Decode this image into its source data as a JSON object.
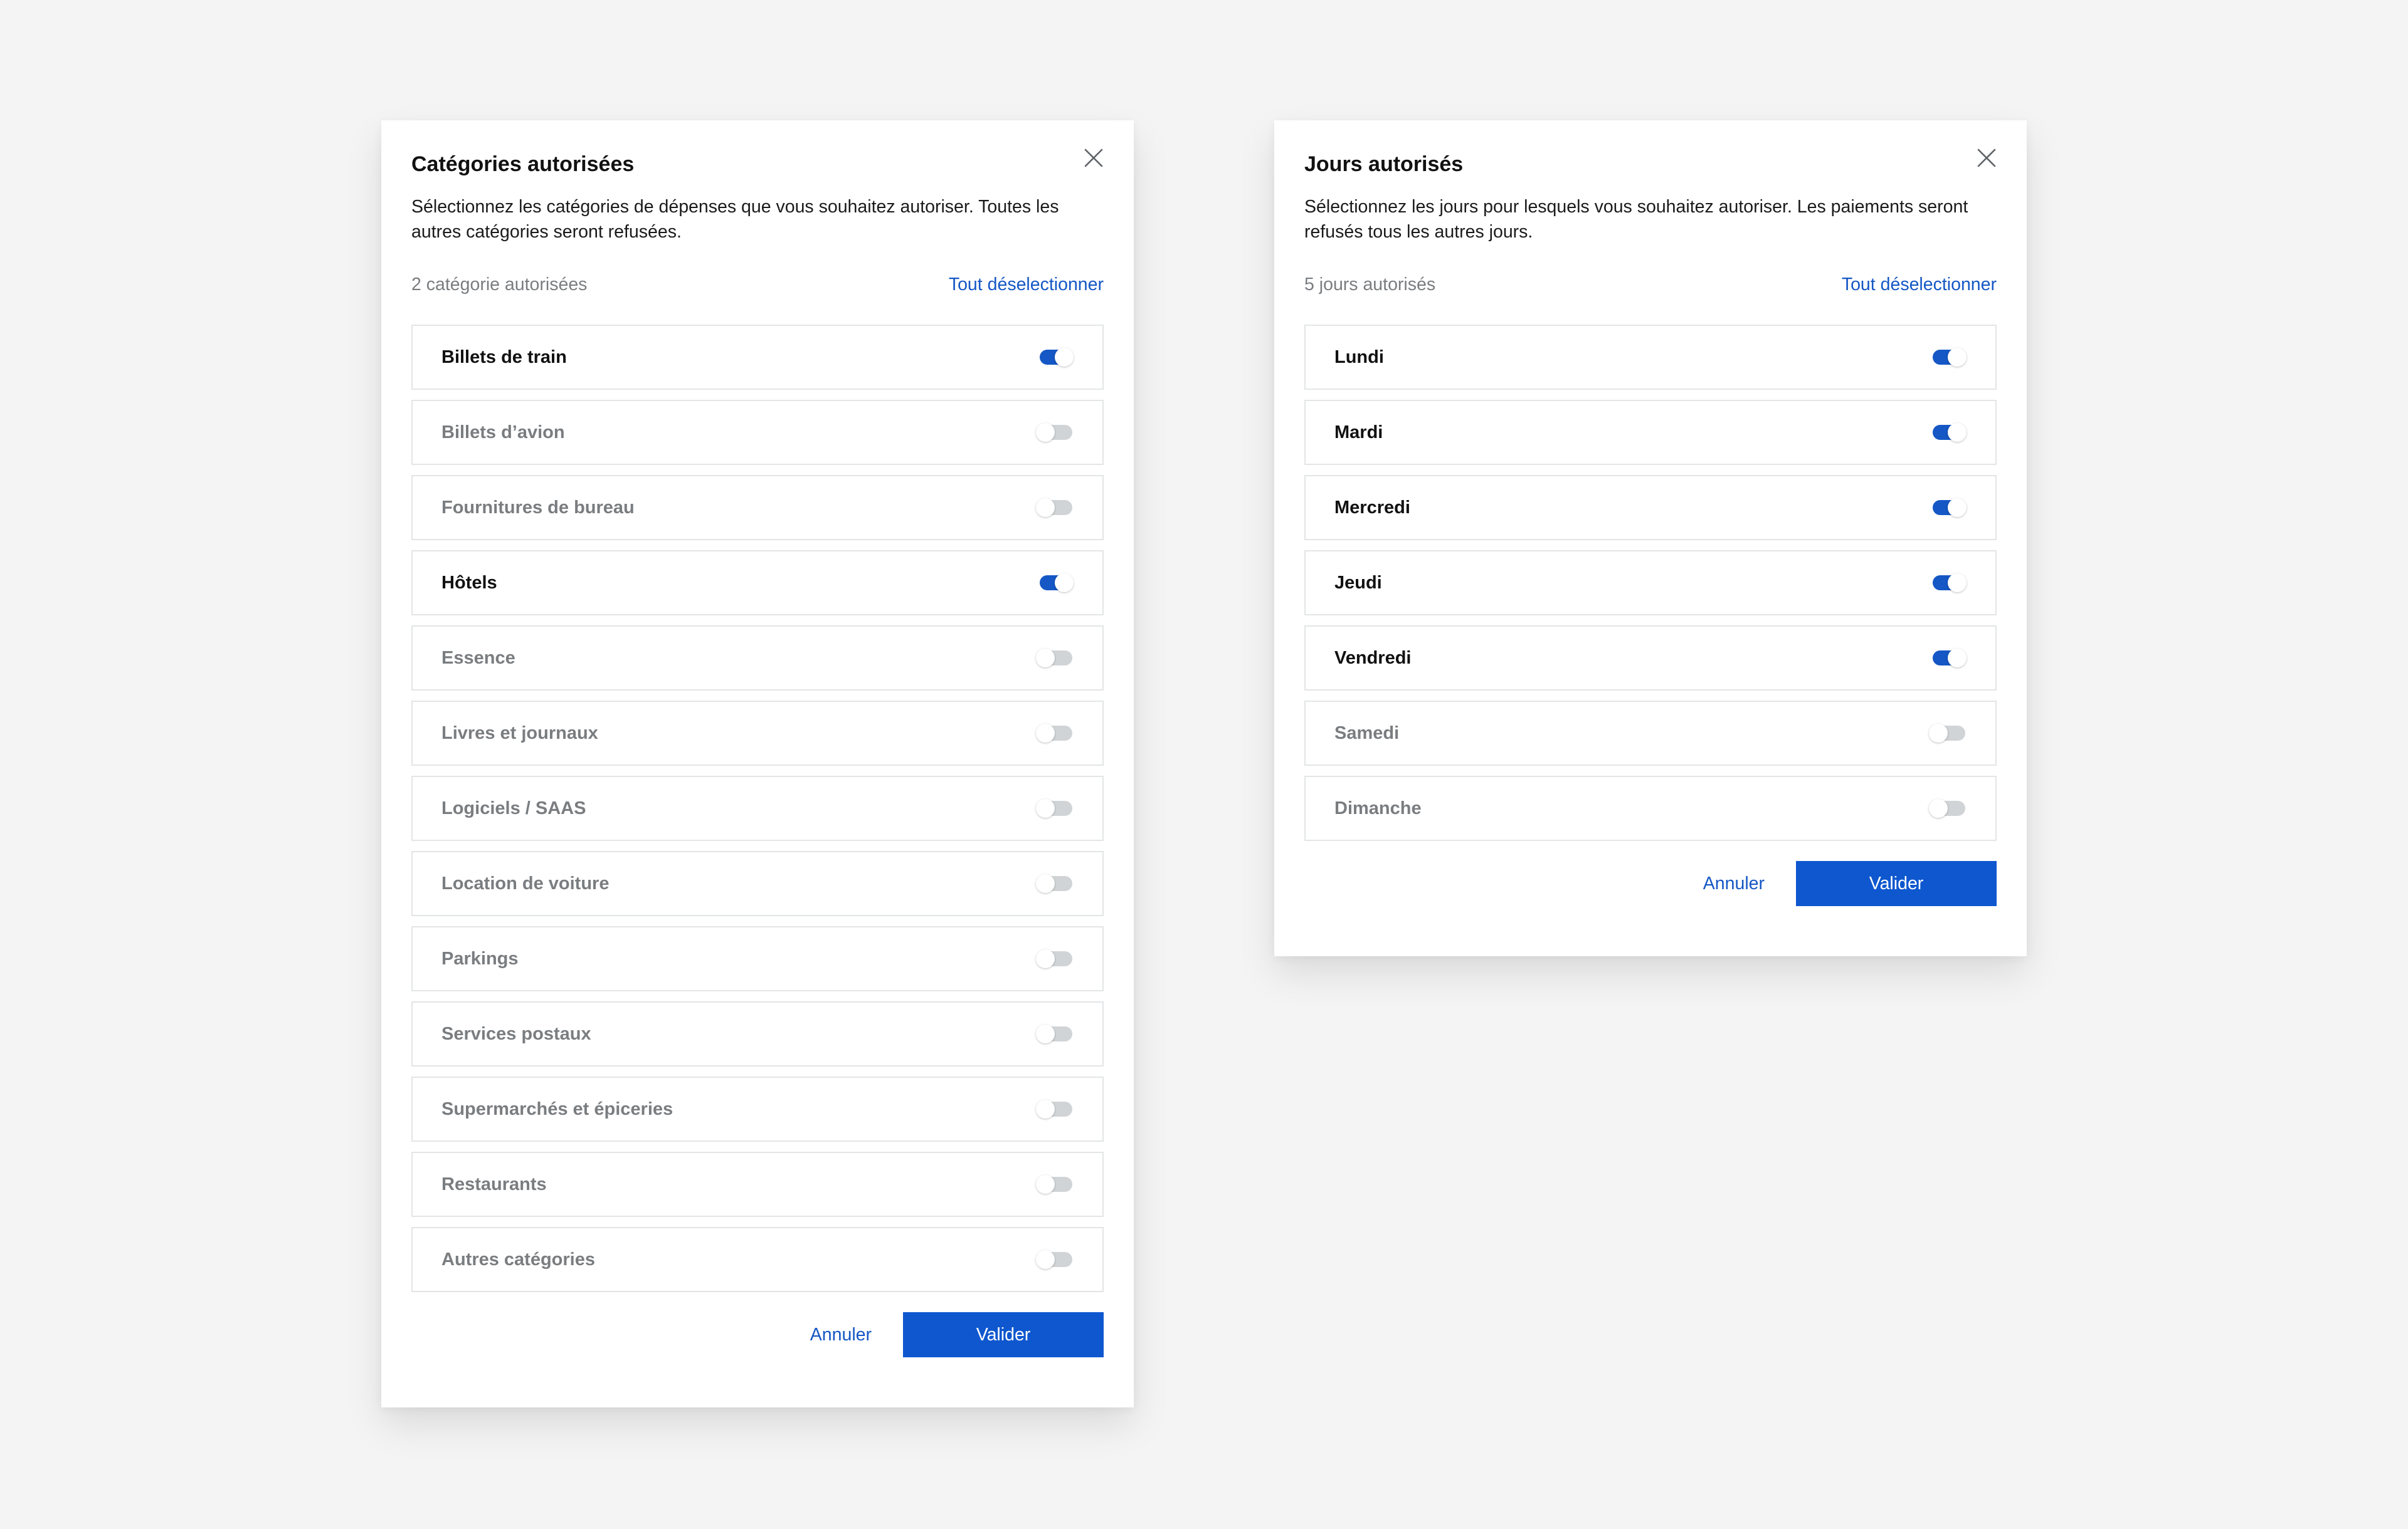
{
  "categories_modal": {
    "title": "Catégories autorisées",
    "description": "Sélectionnez les catégories de dépenses que vous souhaitez autoriser. Toutes les autres catégories seront refusées.",
    "count_text": "2 catégorie autorisées",
    "deselect_all": "Tout déselectionner",
    "items": [
      {
        "label": "Billets de train",
        "enabled": true
      },
      {
        "label": "Billets d’avion",
        "enabled": false
      },
      {
        "label": "Fournitures de bureau",
        "enabled": false
      },
      {
        "label": "Hôtels",
        "enabled": true
      },
      {
        "label": "Essence",
        "enabled": false
      },
      {
        "label": "Livres et journaux",
        "enabled": false
      },
      {
        "label": "Logiciels / SAAS",
        "enabled": false
      },
      {
        "label": "Location de voiture",
        "enabled": false
      },
      {
        "label": "Parkings",
        "enabled": false
      },
      {
        "label": "Services postaux",
        "enabled": false
      },
      {
        "label": "Supermarchés et épiceries",
        "enabled": false
      },
      {
        "label": "Restaurants",
        "enabled": false
      },
      {
        "label": "Autres catégories",
        "enabled": false
      }
    ],
    "cancel_label": "Annuler",
    "confirm_label": "Valider"
  },
  "days_modal": {
    "title": "Jours autorisés",
    "description": "Sélectionnez les jours pour lesquels vous souhaitez autoriser. Les paiements seront refusés tous les autres jours.",
    "count_text": "5 jours autorisés",
    "deselect_all": "Tout déselectionner",
    "items": [
      {
        "label": "Lundi",
        "enabled": true
      },
      {
        "label": "Mardi",
        "enabled": true
      },
      {
        "label": "Mercredi",
        "enabled": true
      },
      {
        "label": "Jeudi",
        "enabled": true
      },
      {
        "label": "Vendredi",
        "enabled": true
      },
      {
        "label": "Samedi",
        "enabled": false
      },
      {
        "label": "Dimanche",
        "enabled": false
      }
    ],
    "cancel_label": "Annuler",
    "confirm_label": "Valider"
  },
  "colors": {
    "accent": "#1557c5",
    "primary_button": "#0e57cf",
    "background": "#f3f4f3",
    "muted_text": "#7a7d80",
    "toggle_off": "#d1d4d6",
    "border": "#e3e5e6"
  },
  "icons": {
    "close": "close-icon"
  }
}
